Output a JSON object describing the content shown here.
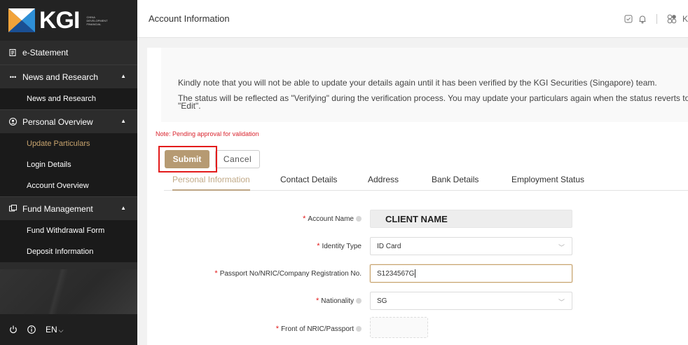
{
  "brand": {
    "logo_text": "KGI",
    "logo_sub": "CHINA DEVELOPMENT FINANCIAL",
    "accent": "#b69a72",
    "dark": "#2c2c2c",
    "alert": "#e31b1b"
  },
  "sidebar": {
    "top_item": {
      "label": "e-Statement",
      "icon": "document-icon"
    },
    "groups": [
      {
        "label": "News and Research",
        "icon": "dots-icon",
        "items": [
          "News and Research"
        ]
      },
      {
        "label": "Personal Overview",
        "icon": "person-circle-icon",
        "items": [
          "Update Particulars",
          "Login Details",
          "Account Overview"
        ],
        "active_index": 0
      },
      {
        "label": "Fund Management",
        "icon": "fund-icon",
        "items": [
          "Fund Withdrawal Form",
          "Deposit Information"
        ]
      }
    ],
    "footer": {
      "power_icon": "power-icon",
      "info_icon": "info-icon",
      "language": "EN"
    }
  },
  "header": {
    "title": "Account Information",
    "user_initial": "K"
  },
  "notice": {
    "line1": "Kindly note that you will not be able to update your details again until it has been verified by the KGI Securities (Singapore) team.",
    "line2": "The status will be reflected as \"Verifying\" during the verification process. You may update your particulars again when the status reverts to",
    "line3": "\"Edit\"."
  },
  "pending_note": "Note: Pending approval for validation",
  "actions": {
    "submit": "Submit",
    "cancel": "Cancel"
  },
  "tabs": [
    "Personal Information",
    "Contact Details",
    "Address",
    "Bank Details",
    "Employment Status"
  ],
  "form": {
    "account_name": {
      "label": "Account Name",
      "value": "CLIENT NAME"
    },
    "identity_type": {
      "label": "Identity Type",
      "value": "ID Card"
    },
    "passport_no": {
      "label": "Passport No/NRIC/Company Registration No.",
      "value": "S1234567G"
    },
    "nationality": {
      "label": "Nationality",
      "value": "SG"
    },
    "front_nric": {
      "label": "Front of NRIC/Passport"
    }
  }
}
